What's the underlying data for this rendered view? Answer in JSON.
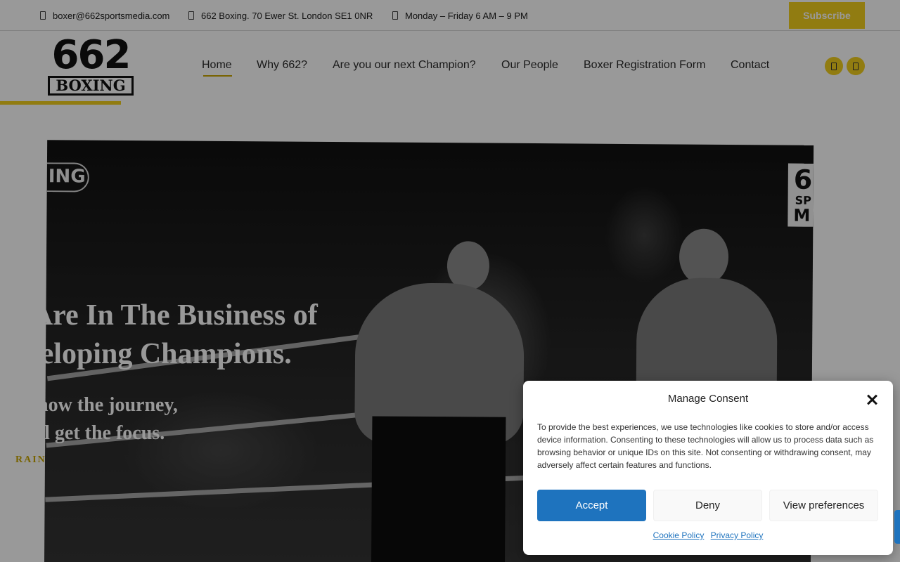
{
  "topbar": {
    "email": "boxer@662sportsmedia.com",
    "address": "662 Boxing. 70 Ewer St. London SE1 0NR",
    "hours": "Monday – Friday 6 AM – 9 PM",
    "subscribe_label": "Subscribe"
  },
  "header": {
    "logo_number": "662",
    "logo_word": "BOXING",
    "nav": [
      {
        "label": "Home",
        "active": true
      },
      {
        "label": "Why 662?"
      },
      {
        "label": "Are you our next Champion?"
      },
      {
        "label": "Our People"
      },
      {
        "label": "Boxer Registration Form"
      },
      {
        "label": "Contact"
      }
    ],
    "social_icons": [
      "social-icon-1",
      "social-icon-2"
    ]
  },
  "hero": {
    "headline_line1": "e Are In The Business of",
    "headline_line2": "eveloping Champions.",
    "subline_line1": "e know the journey,",
    "subline_line2": "ou'll get the focus.",
    "cta": "RAIN",
    "watermark_left": "ING",
    "watermark_right_top": "6",
    "watermark_right_mid": "SP",
    "watermark_right_bottom": "M"
  },
  "consent": {
    "title": "Manage Consent",
    "body": "To provide the best experiences, we use technologies like cookies to store and/or access device information. Consenting to these technologies will allow us to process data such as browsing behavior or unique IDs on this site. Not consenting or withdrawing consent, may adversely affect certain features and functions.",
    "accept_label": "Accept",
    "deny_label": "Deny",
    "preferences_label": "View preferences",
    "cookie_policy_label": "Cookie Policy",
    "privacy_policy_label": "Privacy Policy"
  },
  "colors": {
    "accent_yellow": "#f2cf1d",
    "accept_blue": "#1e73be"
  }
}
